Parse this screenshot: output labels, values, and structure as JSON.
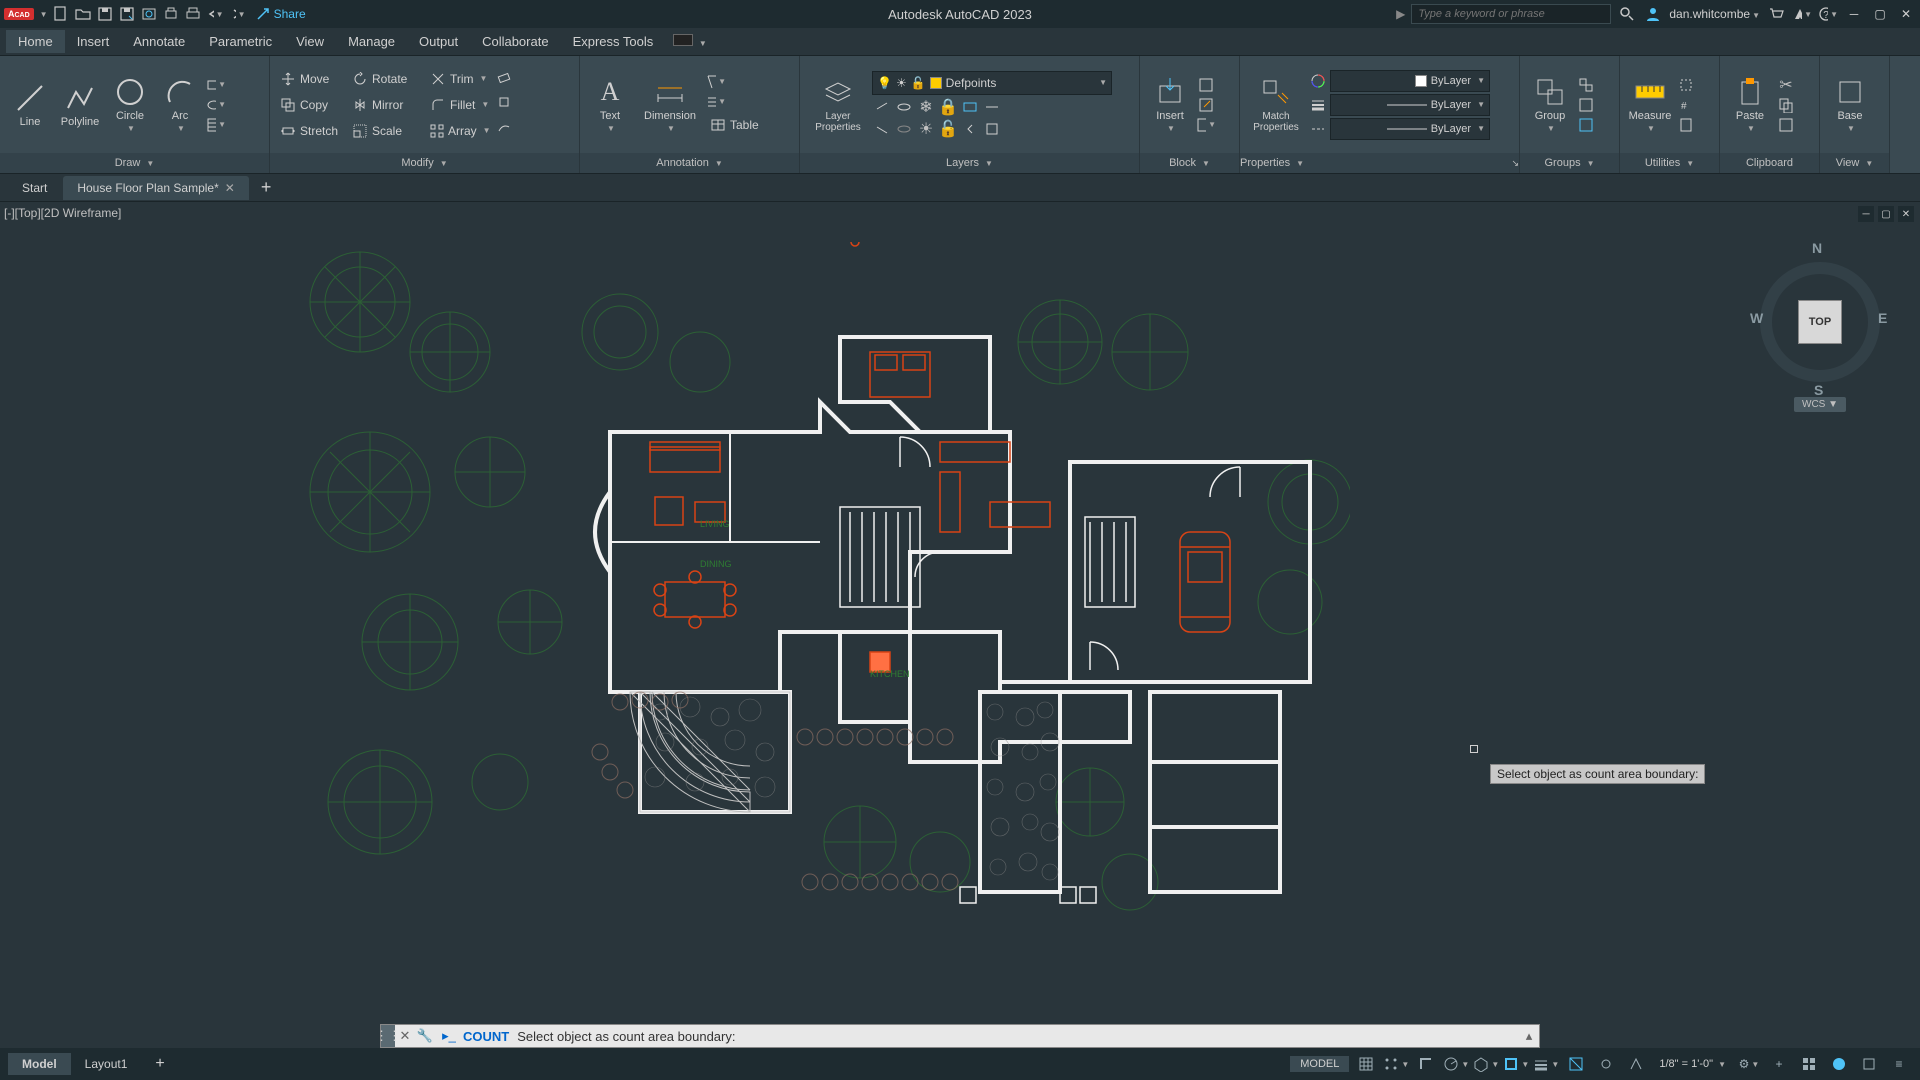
{
  "app": {
    "badge": "CAD",
    "title": "Autodesk AutoCAD 2023",
    "share_label": "Share",
    "search_placeholder": "Type a keyword or phrase",
    "user": "dan.whitcombe"
  },
  "menubar": {
    "tabs": [
      "Home",
      "Insert",
      "Annotate",
      "Parametric",
      "View",
      "Manage",
      "Output",
      "Collaborate",
      "Express Tools"
    ]
  },
  "ribbon": {
    "draw": {
      "title": "Draw",
      "line": "Line",
      "polyline": "Polyline",
      "circle": "Circle",
      "arc": "Arc"
    },
    "modify": {
      "title": "Modify",
      "move": "Move",
      "rotate": "Rotate",
      "trim": "Trim",
      "copy": "Copy",
      "mirror": "Mirror",
      "fillet": "Fillet",
      "stretch": "Stretch",
      "scale": "Scale",
      "array": "Array"
    },
    "annotation": {
      "title": "Annotation",
      "text": "Text",
      "dimension": "Dimension",
      "table": "Table"
    },
    "layers": {
      "title": "Layers",
      "layer_properties": "Layer\nProperties",
      "current_layer": "Defpoints"
    },
    "block": {
      "title": "Block",
      "insert": "Insert"
    },
    "properties": {
      "title": "Properties",
      "match": "Match\nProperties",
      "color": "ByLayer",
      "lineweight": "ByLayer",
      "linetype": "ByLayer"
    },
    "groups": {
      "title": "Groups",
      "group": "Group"
    },
    "utilities": {
      "title": "Utilities",
      "measure": "Measure"
    },
    "clipboard": {
      "title": "Clipboard",
      "paste": "Paste"
    },
    "view": {
      "title": "View",
      "base": "Base"
    }
  },
  "filetabs": {
    "start": "Start",
    "current": "House Floor Plan Sample*"
  },
  "viewport": {
    "label": "[-][Top][2D Wireframe]",
    "rooms": {
      "living": "LIVING",
      "dining": "DINING",
      "kitchen": "KITCHEN"
    }
  },
  "viewcube": {
    "face": "TOP",
    "n": "N",
    "s": "S",
    "e": "E",
    "w": "W",
    "wcs": "WCS"
  },
  "tooltip": "Select object as count area boundary:",
  "command": {
    "name": "COUNT",
    "prompt": "Select object as count area boundary:"
  },
  "bottomtabs": {
    "model": "Model",
    "layout1": "Layout1"
  },
  "status": {
    "model_space": "MODEL",
    "scale": "1/8\" = 1'-0\""
  }
}
